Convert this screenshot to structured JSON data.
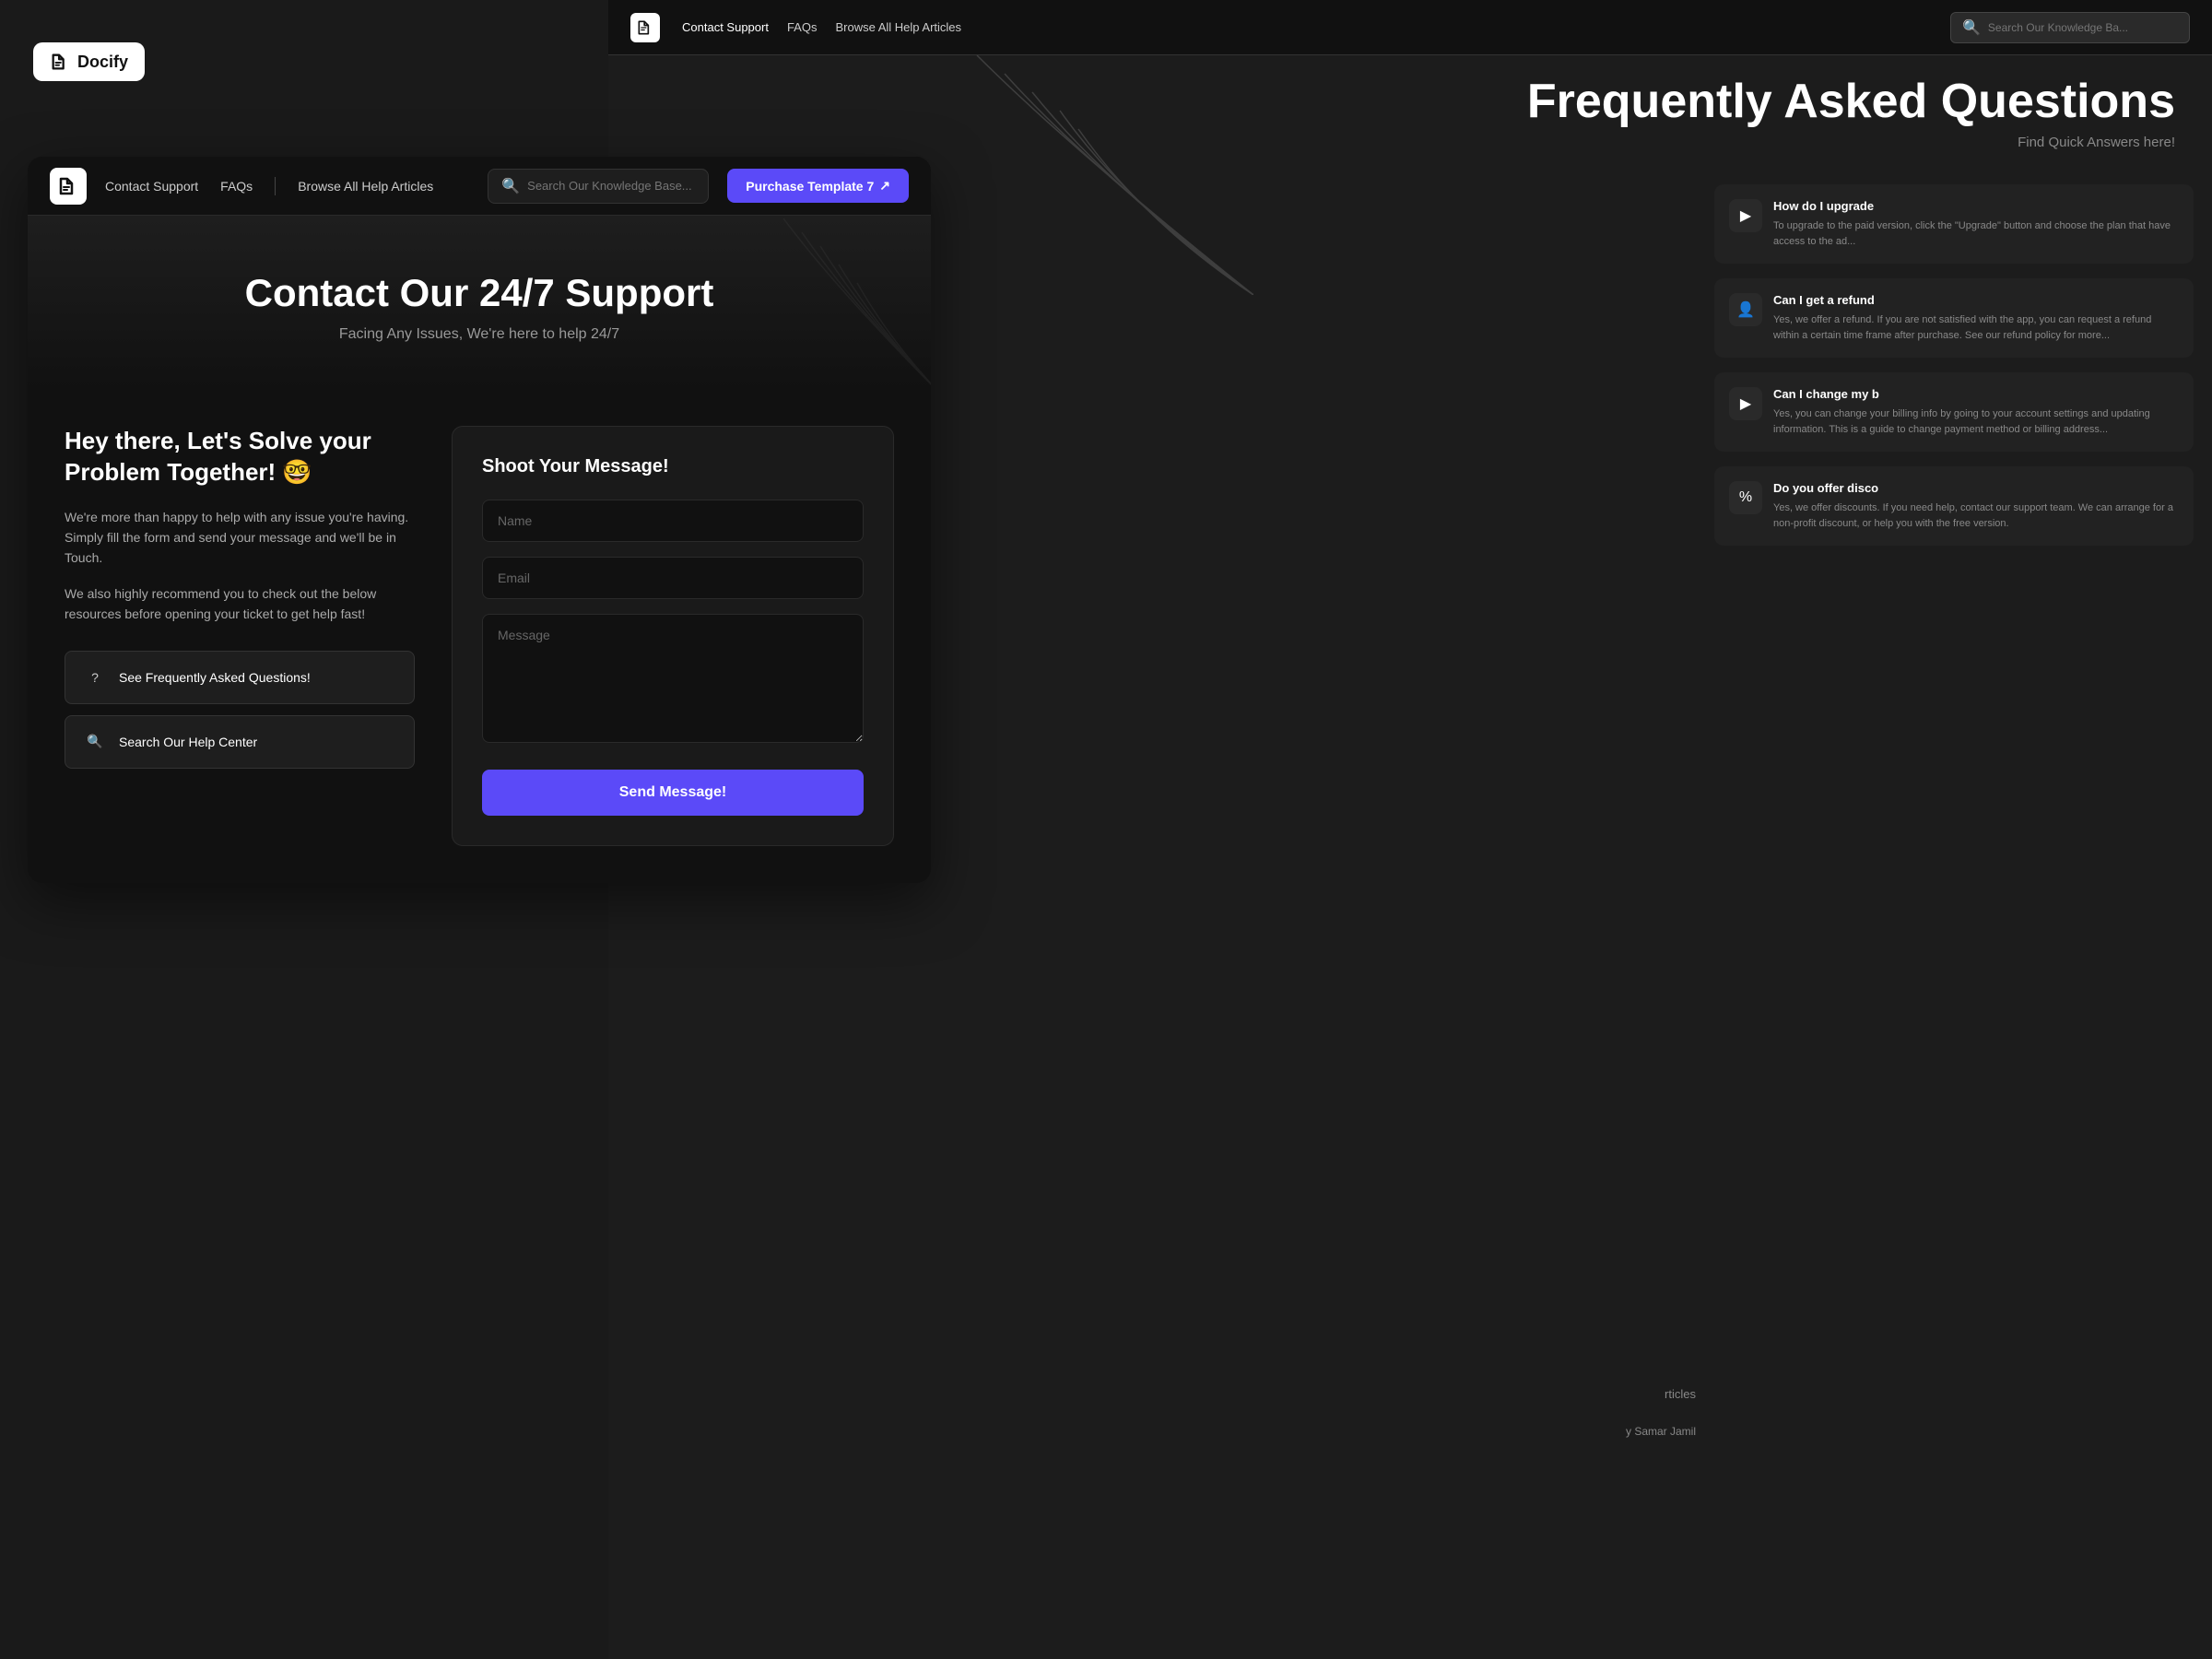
{
  "brand": {
    "name": "Docify",
    "logo_alt": "Docify logo"
  },
  "bg_navbar": {
    "logo_alt": "Docify icon",
    "links": [
      {
        "label": "Contact Support",
        "active": true
      },
      {
        "label": "FAQs",
        "active": false
      },
      {
        "label": "Browse All Help Articles",
        "active": false
      }
    ],
    "search_placeholder": "Search Our Knowledge Ba..."
  },
  "bg_faq": {
    "title": "Frequently Asked Questions",
    "subtitle": "Find Quick Answers here!",
    "cards": [
      {
        "icon": "▶",
        "title": "How do I upgrade",
        "text": "To upgrade to the paid version, click the \"Upgrade\" button and choose the plan that have access to the ad..."
      },
      {
        "icon": "👤",
        "title": "Can I get a refund",
        "text": "Yes, we offer a refund. If you are not satisfied with the app, you can request a refund within a certain time frame after purchase. See our refund policy for more..."
      },
      {
        "icon": "▶",
        "title": "Can I change my b",
        "text": "Yes, you can change your billing info by going to your account settings and updating information. This is a guide to change payment method or billing address..."
      },
      {
        "icon": "%",
        "title": "Do you offer disco",
        "text": "Yes, we offer discounts. If you need help, contact our support team. We can arrange for a non-profit discount, or help you with the free version."
      }
    ]
  },
  "navbar": {
    "logo_alt": "Docify icon",
    "links": [
      {
        "label": "Contact Support"
      },
      {
        "label": "FAQs"
      },
      {
        "label": "Browse All Help Articles"
      }
    ],
    "search_placeholder": "Search Our Knowledge Base...",
    "purchase_btn": "Purchase Template 7",
    "purchase_icon": "↗"
  },
  "hero": {
    "title": "Contact Our 24/7 Support",
    "subtitle": "Facing Any Issues, We're here to help 24/7"
  },
  "left": {
    "heading": "Hey there, Let's Solve your Problem Together! 🤓",
    "description": "We're more than happy to help with any issue you're having. Simply fill the form and send your message and we'll be in Touch.",
    "recommendation": "We also highly recommend you to check out the below resources before opening your ticket to get help fast!",
    "buttons": [
      {
        "icon": "?",
        "label": "See Frequently Asked Questions!"
      },
      {
        "icon": "🔍",
        "label": "Search Our Help Center"
      }
    ]
  },
  "form": {
    "title": "Shoot Your Message!",
    "name_placeholder": "Name",
    "email_placeholder": "Email",
    "message_placeholder": "Message",
    "send_label": "Send Message!"
  },
  "bottom_search": {
    "label": "Search Our Help Center"
  }
}
